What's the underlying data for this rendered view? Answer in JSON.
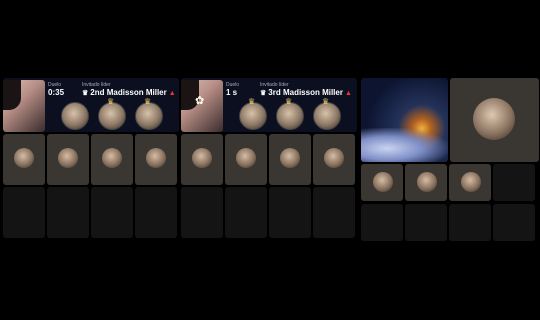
{
  "panels": [
    {
      "duel_label": "Duelo",
      "timer": "0:35",
      "guest_label": "Invitado líder",
      "rank_text": "2nd Madisson Miller",
      "cohost_avatars": 3,
      "cells_active": [
        true,
        true,
        true,
        true,
        false,
        false,
        false,
        false
      ]
    },
    {
      "duel_label": "Duelo",
      "timer": "1 s",
      "guest_label": "Invitado líder",
      "rank_text": "3rd Madisson Miller",
      "cohost_avatars": 3,
      "cells_active": [
        true,
        true,
        true,
        true,
        false,
        false,
        false,
        false
      ]
    },
    {
      "cells_active": [
        true,
        true,
        true,
        false,
        false,
        false,
        false,
        false
      ]
    }
  ],
  "icons": {
    "crown": "crown-icon",
    "hat": "red-hat-icon",
    "flower": "flower-icon"
  }
}
